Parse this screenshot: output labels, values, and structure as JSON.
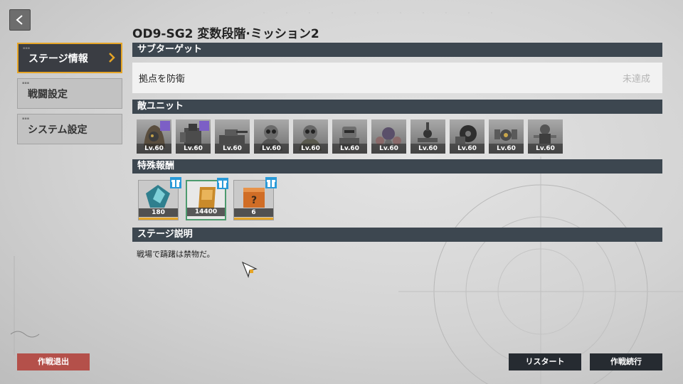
{
  "header": {
    "title": "OD9-SG2 変数段階·ミッション2"
  },
  "sidebar": {
    "items": [
      {
        "label": "ステージ情報",
        "active": true
      },
      {
        "label": "戦闘設定",
        "active": false
      },
      {
        "label": "システム設定",
        "active": false
      }
    ]
  },
  "sections": {
    "sub_target": "サブターゲット",
    "enemy_units": "敵ユニット",
    "special_rewards": "特殊報酬",
    "stage_desc": "ステージ説明"
  },
  "sub_target": {
    "text": "拠点を防衛",
    "status": "未達成"
  },
  "enemies": [
    {
      "level": "Lv.60",
      "boss": true,
      "icon": "hooded-gasmask-unit"
    },
    {
      "level": "Lv.60",
      "boss": true,
      "icon": "heavy-mech-unit"
    },
    {
      "level": "Lv.60",
      "boss": false,
      "icon": "tank-unit"
    },
    {
      "level": "Lv.60",
      "boss": false,
      "icon": "gasmask-soldier-unit"
    },
    {
      "level": "Lv.60",
      "boss": false,
      "icon": "gasmask-soldier-unit"
    },
    {
      "level": "Lv.60",
      "boss": false,
      "icon": "robot-unit"
    },
    {
      "level": "Lv.60",
      "boss": false,
      "icon": "crab-mech-unit"
    },
    {
      "level": "Lv.60",
      "boss": false,
      "icon": "drone-turret-unit"
    },
    {
      "level": "Lv.60",
      "boss": false,
      "icon": "sawblade-unit"
    },
    {
      "level": "Lv.60",
      "boss": false,
      "icon": "bomb-drone-unit"
    },
    {
      "level": "Lv.60",
      "boss": false,
      "icon": "walker-unit"
    }
  ],
  "rewards": [
    {
      "count": "180",
      "icon": "blue-crystal-icon",
      "selected": false
    },
    {
      "count": "14400",
      "icon": "gold-bar-icon",
      "selected": true
    },
    {
      "count": "6",
      "icon": "mystery-box-icon",
      "selected": false
    }
  ],
  "description": "戦場で躊躇は禁物だ。",
  "buttons": {
    "exit": "作戦退出",
    "restart": "リスタート",
    "continue": "作戦続行"
  },
  "colors": {
    "accent": "#e5a527",
    "header_bg": "#3d4750",
    "exit_btn": "#b4504a",
    "boss_badge": "#7c5fc6",
    "gift_badge": "#2a9ad8"
  }
}
